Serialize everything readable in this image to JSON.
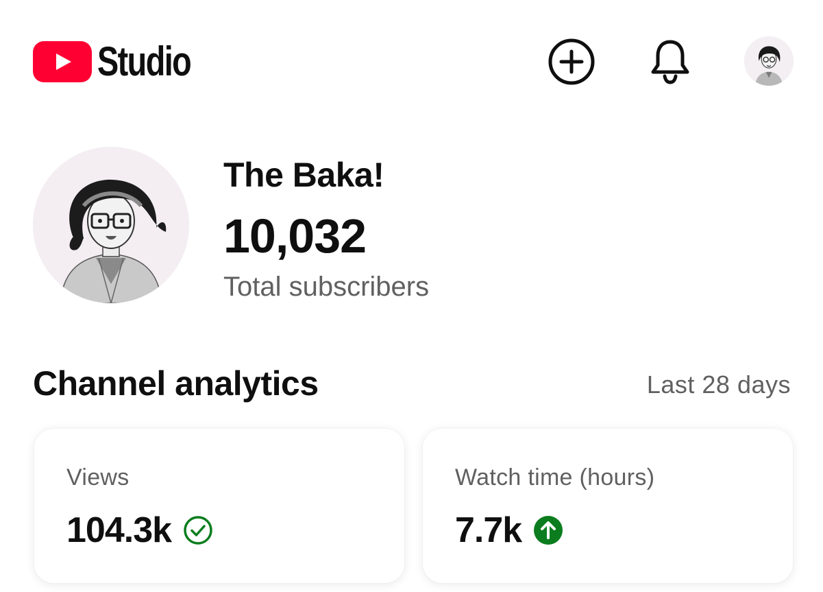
{
  "header": {
    "app_name": "Studio",
    "icons": [
      "youtube-logo-icon",
      "create-icon",
      "notifications-bell-icon",
      "account-avatar"
    ]
  },
  "channel": {
    "name": "The Baka!",
    "subscriber_count": "10,032",
    "subscriber_label": "Total subscribers"
  },
  "analytics": {
    "title": "Channel analytics",
    "period": "Last 28 days",
    "cards": [
      {
        "label": "Views",
        "value": "104.3k",
        "status_icon": "check-circle-icon"
      },
      {
        "label": "Watch time (hours)",
        "value": "7.7k",
        "status_icon": "arrow-up-circle-icon"
      }
    ]
  },
  "colors": {
    "brand_red": "#ff0033",
    "status_green": "#0b7d1e",
    "secondary_text": "#606060"
  }
}
